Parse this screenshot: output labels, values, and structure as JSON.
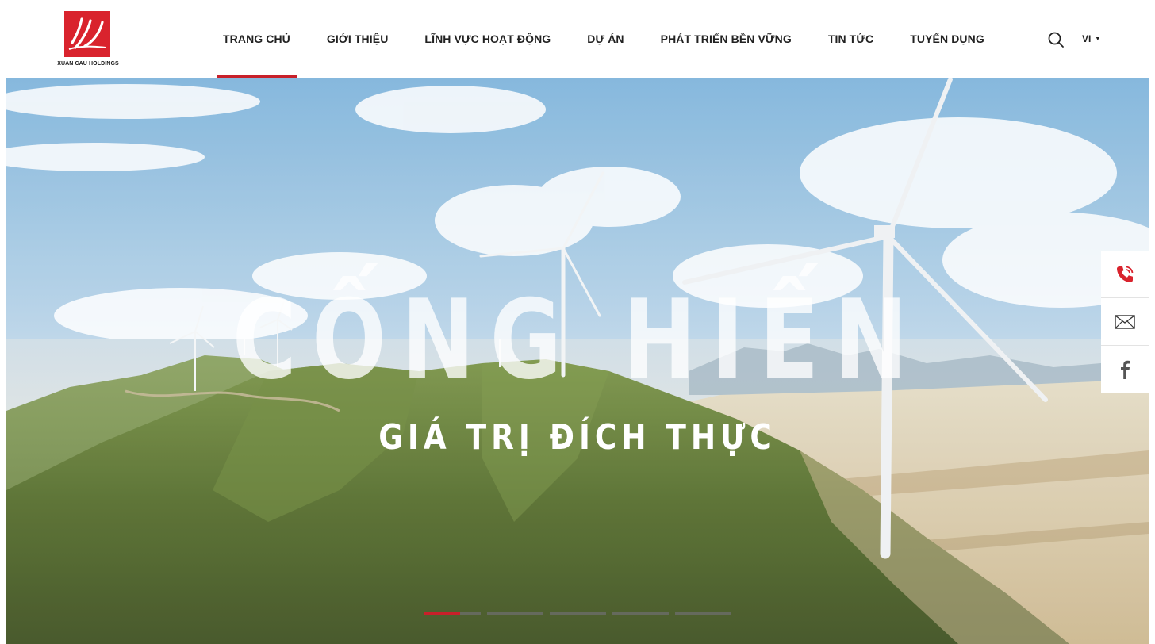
{
  "brand": {
    "name": "XUAN CAU HOLDINGS",
    "color": "#d9232d"
  },
  "nav": {
    "items": [
      {
        "label": "TRANG CHỦ",
        "active": true
      },
      {
        "label": "GIỚI THIỆU",
        "active": false
      },
      {
        "label": "LĨNH VỰC HOẠT ĐỘNG",
        "active": false
      },
      {
        "label": "DỰ ÁN",
        "active": false
      },
      {
        "label": "PHÁT TRIỂN BỀN VỮNG",
        "active": false
      },
      {
        "label": "TIN TỨC",
        "active": false
      },
      {
        "label": "TUYỂN DỤNG",
        "active": false
      }
    ],
    "accent": "#c8202a"
  },
  "header_tools": {
    "search_icon": "search-icon",
    "language": "VI"
  },
  "hero": {
    "headline": "CỐNG HIẾN",
    "subline": "GIÁ TRỊ ĐÍCH THỰC",
    "slides_total": 5,
    "slide_active": 1
  },
  "contact": {
    "items": [
      {
        "icon": "phone-icon"
      },
      {
        "icon": "mail-icon"
      },
      {
        "icon": "facebook-icon"
      }
    ]
  }
}
